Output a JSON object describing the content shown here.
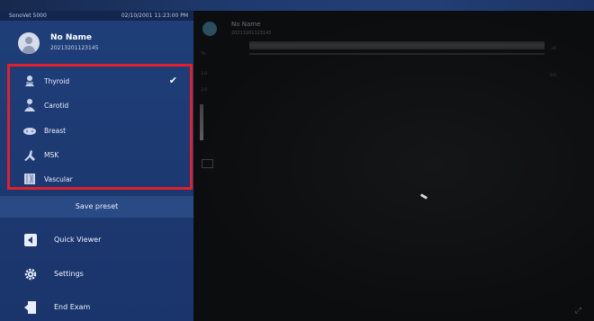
{
  "status_bar": {
    "left": "SonoVet 5000",
    "right": "02/10/2001 11:23:00 PM"
  },
  "profile": {
    "name": "No Name",
    "id": "20213201123145"
  },
  "presets": [
    {
      "label": "Thyroid",
      "icon": "thyroid-icon",
      "selected": true
    },
    {
      "label": "Carotid",
      "icon": "carotid-icon",
      "selected": false
    },
    {
      "label": "Breast",
      "icon": "breast-icon",
      "selected": false
    },
    {
      "label": "MSK",
      "icon": "msk-icon",
      "selected": false
    },
    {
      "label": "Vascular",
      "icon": "vascular-icon",
      "selected": false
    }
  ],
  "save_preset": "Save preset",
  "menu": [
    {
      "label": "Quick Viewer",
      "icon": "quick-viewer-icon"
    },
    {
      "label": "Settings",
      "icon": "gear-icon"
    },
    {
      "label": "End Exam",
      "icon": "end-exam-icon"
    }
  ],
  "viewer": {
    "name": "No Name",
    "sub": "20213201123145",
    "left_labels": [
      "Th",
      "1.0",
      "2.0"
    ],
    "right_labels": [
      "34",
      "0.0"
    ]
  },
  "colors": {
    "sidebar": "#1f3f7a",
    "highlight_border": "#e0202a",
    "viewer_bg": "#0c0d0f"
  }
}
